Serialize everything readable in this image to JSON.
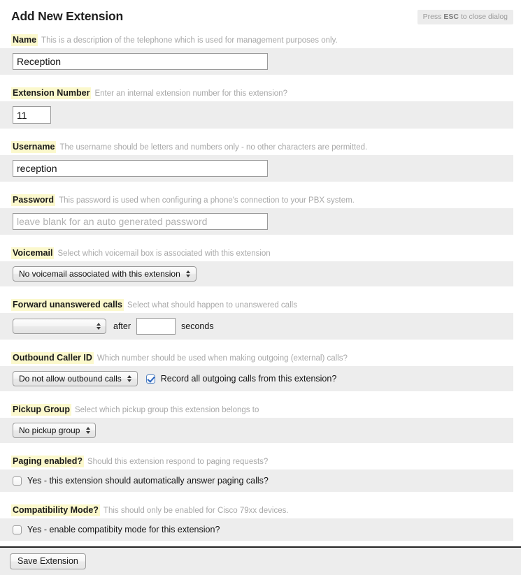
{
  "header": {
    "title": "Add New Extension",
    "esc_prefix": "Press ",
    "esc_key": "ESC",
    "esc_suffix": " to close dialog"
  },
  "fields": {
    "name": {
      "label": "Name",
      "hint": "This is a description of the telephone which is used for management purposes only.",
      "value": "Reception",
      "placeholder": ""
    },
    "extension_number": {
      "label": "Extension Number",
      "hint": "Enter an internal extension number for this extension?",
      "value": "11",
      "placeholder": ""
    },
    "username": {
      "label": "Username",
      "hint": "The username should be letters and numbers only - no other characters are permitted.",
      "value": "reception",
      "placeholder": ""
    },
    "password": {
      "label": "Password",
      "hint": "This password is used when configuring a phone's connection to your PBX system.",
      "value": "",
      "placeholder": "leave blank for an auto generated password"
    },
    "voicemail": {
      "label": "Voicemail",
      "hint": "Select which voicemail box is associated with this extension",
      "selected": "No voicemail associated with this extension"
    },
    "forward_unanswered": {
      "label": "Forward unanswered calls",
      "hint": "Select what should happen to unanswered calls",
      "selected": "",
      "after_text": "after",
      "seconds_value": "",
      "seconds_text": "seconds"
    },
    "outbound_caller_id": {
      "label": "Outbound Caller ID",
      "hint": "Which number should be used when making outgoing (external) calls?",
      "selected": "Do not allow outbound calls",
      "record_checkbox_label": "Record all outgoing calls from this extension?",
      "record_checked": true
    },
    "pickup_group": {
      "label": "Pickup Group",
      "hint": "Select which pickup group this extension belongs to",
      "selected": "No pickup group"
    },
    "paging_enabled": {
      "label": "Paging enabled?",
      "hint": "Should this extension respond to paging requests?",
      "checkbox_label": "Yes - this extension should automatically answer paging calls?",
      "checked": false
    },
    "compatibility_mode": {
      "label": "Compatibility Mode?",
      "hint": "This should only be enabled for Cisco 79xx devices.",
      "checkbox_label": "Yes - enable compatibity mode for this extension?",
      "checked": false
    }
  },
  "footer": {
    "save_label": "Save Extension"
  },
  "colors": {
    "label_highlight": "#fbf8cc",
    "row_background": "#ededed",
    "hint_text": "#a8a8a8",
    "checkbox_accent": "#2a64bd"
  }
}
